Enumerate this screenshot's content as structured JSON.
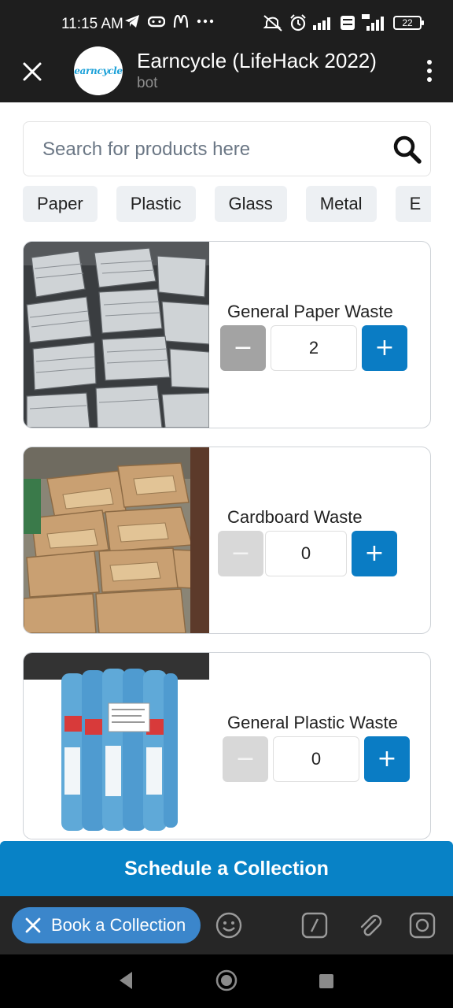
{
  "status_bar": {
    "time": "11:15 AM",
    "battery": "22",
    "icons": [
      "telegram-icon",
      "game-controller-icon",
      "mcdonalds-icon",
      "more-dots-icon",
      "mute-icon",
      "alarm-icon",
      "signal-icon",
      "volte-icon",
      "4g-signal-icon",
      "battery-icon"
    ]
  },
  "header": {
    "avatar_text": "earncycle",
    "title": "Earncycle (LifeHack 2022)",
    "subtitle": "bot"
  },
  "search": {
    "placeholder": "Search for products here"
  },
  "categories": [
    "Paper",
    "Plastic",
    "Glass",
    "Metal",
    "E"
  ],
  "products": [
    {
      "name": "General Paper Waste",
      "quantity": "2",
      "minus": "−",
      "plus": "+"
    },
    {
      "name": "Cardboard Waste",
      "quantity": "0",
      "minus": "−",
      "plus": "+"
    },
    {
      "name": "General Plastic Waste",
      "quantity": "0",
      "minus": "−",
      "plus": "+"
    }
  ],
  "schedule_button": "Schedule a Collection",
  "input_bar": {
    "book_button": "Book a Collection",
    "icons": [
      "emoji-icon",
      "slash-command-icon",
      "attach-icon",
      "camera-icon"
    ]
  },
  "colors": {
    "accent": "#0882c6",
    "plus_button": "#0a7cc4",
    "book_button": "#3b86cb",
    "header_bg": "#1e1e1e"
  }
}
